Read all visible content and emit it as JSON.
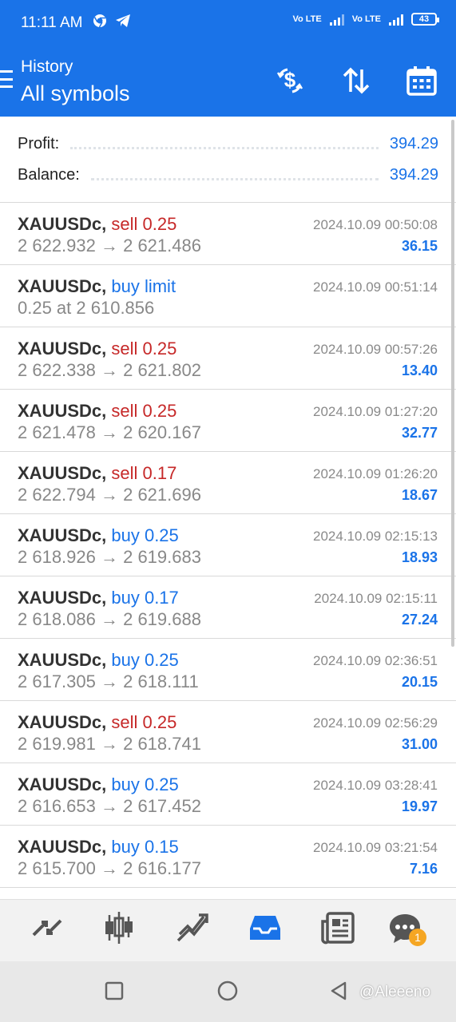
{
  "status_bar": {
    "time": "11:11 AM",
    "network_label_1": "Vo LTE",
    "network_label_2": "Vo LTE",
    "battery": "43",
    "icons": [
      "chrome-icon",
      "telegram-icon",
      "signal-icon",
      "battery-icon"
    ]
  },
  "app_bar": {
    "subtitle": "History",
    "title": "All symbols",
    "icons": [
      "menu-icon",
      "deposit-dollar-icon",
      "sort-icon",
      "calendar-icon"
    ]
  },
  "summary": {
    "profit_label": "Profit:",
    "profit_value": "394.29",
    "balance_label": "Balance:",
    "balance_value": "394.29"
  },
  "deals": [
    {
      "symbol": "XAUUSDc,",
      "side": "sell",
      "side_text": "sell 0.25",
      "prices": "2 622.932 → 2 621.486",
      "time": "2024.10.09 00:50:08",
      "profit": "36.15"
    },
    {
      "symbol": "XAUUSDc,",
      "side": "buy",
      "side_text": "buy limit",
      "prices": "0.25 at 2 610.856",
      "time": "2024.10.09 00:51:14",
      "profit": ""
    },
    {
      "symbol": "XAUUSDc,",
      "side": "sell",
      "side_text": "sell 0.25",
      "prices": "2 622.338 → 2 621.802",
      "time": "2024.10.09 00:57:26",
      "profit": "13.40"
    },
    {
      "symbol": "XAUUSDc,",
      "side": "sell",
      "side_text": "sell 0.25",
      "prices": "2 621.478 → 2 620.167",
      "time": "2024.10.09 01:27:20",
      "profit": "32.77"
    },
    {
      "symbol": "XAUUSDc,",
      "side": "sell",
      "side_text": "sell 0.17",
      "prices": "2 622.794 → 2 621.696",
      "time": "2024.10.09 01:26:20",
      "profit": "18.67"
    },
    {
      "symbol": "XAUUSDc,",
      "side": "buy",
      "side_text": "buy 0.25",
      "prices": "2 618.926 → 2 619.683",
      "time": "2024.10.09 02:15:13",
      "profit": "18.93"
    },
    {
      "symbol": "XAUUSDc,",
      "side": "buy",
      "side_text": "buy 0.17",
      "prices": "2 618.086 → 2 619.688",
      "time": "2024.10.09 02:15:11",
      "profit": "27.24"
    },
    {
      "symbol": "XAUUSDc,",
      "side": "buy",
      "side_text": "buy 0.25",
      "prices": "2 617.305 → 2 618.111",
      "time": "2024.10.09 02:36:51",
      "profit": "20.15"
    },
    {
      "symbol": "XAUUSDc,",
      "side": "sell",
      "side_text": "sell 0.25",
      "prices": "2 619.981 → 2 618.741",
      "time": "2024.10.09 02:56:29",
      "profit": "31.00"
    },
    {
      "symbol": "XAUUSDc,",
      "side": "buy",
      "side_text": "buy 0.25",
      "prices": "2 616.653 → 2 617.452",
      "time": "2024.10.09 03:28:41",
      "profit": "19.97"
    },
    {
      "symbol": "XAUUSDc,",
      "side": "buy",
      "side_text": "buy 0.15",
      "prices": "2 615.700 → 2 616.177",
      "time": "2024.10.09 03:21:54",
      "profit": "7.16"
    }
  ],
  "bottom_nav": {
    "items": [
      "quotes-icon",
      "chart-candles-icon",
      "trade-icon",
      "history-inbox-icon",
      "news-icon",
      "chat-icon"
    ],
    "chat_badge": "1",
    "active_color": "#1a73e8"
  },
  "system_nav": {
    "items": [
      "recents-square-icon",
      "home-circle-icon",
      "back-triangle-icon"
    ],
    "watermark": "@Aleeeno"
  },
  "colors": {
    "accent": "#1a73e8",
    "sell": "#c62828",
    "buy": "#1a73e8"
  }
}
